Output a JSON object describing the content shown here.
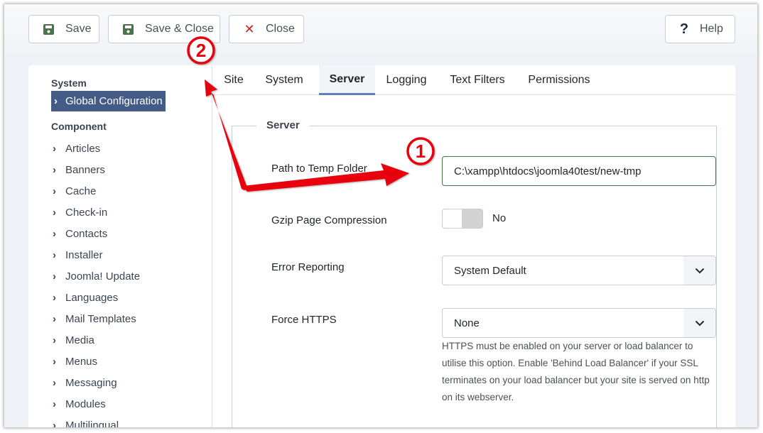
{
  "toolbar": {
    "save": {
      "label": "Save",
      "icon": "floppy-disk-icon",
      "icon_color": "#477549"
    },
    "save_close": {
      "label": "Save & Close",
      "icon": "floppy-disk-icon",
      "icon_color": "#477549"
    },
    "close": {
      "label": "Close",
      "icon": "x-icon",
      "icon_glyph": "✕",
      "icon_color": "#c52827"
    },
    "help": {
      "label": "Help",
      "icon": "question-icon",
      "icon_glyph": "?"
    }
  },
  "sidebar": {
    "system_heading": "System",
    "active_item": "Global Configuration",
    "component_heading": "Component",
    "items": [
      {
        "label": "Articles"
      },
      {
        "label": "Banners"
      },
      {
        "label": "Cache"
      },
      {
        "label": "Check-in"
      },
      {
        "label": "Contacts"
      },
      {
        "label": "Installer"
      },
      {
        "label": "Joomla! Update"
      },
      {
        "label": "Languages"
      },
      {
        "label": "Mail Templates"
      },
      {
        "label": "Media"
      },
      {
        "label": "Menus"
      },
      {
        "label": "Messaging"
      },
      {
        "label": "Modules"
      },
      {
        "label": "Multilingual"
      }
    ],
    "chevron": "›",
    "active_color": "#445b85"
  },
  "tabs": [
    {
      "label": "Site",
      "active": false
    },
    {
      "label": "System",
      "active": false
    },
    {
      "label": "Server",
      "active": true
    },
    {
      "label": "Logging",
      "active": false
    },
    {
      "label": "Text Filters",
      "active": false
    },
    {
      "label": "Permissions",
      "active": false
    }
  ],
  "server": {
    "legend": "Server",
    "temp_path": {
      "label": "Path to Temp Folder",
      "value": "C:\\xampp\\htdocs\\joomla40test/new-tmp"
    },
    "gzip": {
      "label": "Gzip Page Compression",
      "value": "No",
      "enabled": false
    },
    "error_reporting": {
      "label": "Error Reporting",
      "value": "System Default"
    },
    "force_https": {
      "label": "Force HTTPS",
      "value": "None",
      "help": "HTTPS must be enabled on your server or load balancer to utilise this option. Enable 'Behind Load Balancer' if your SSL terminates on your load balancer but your site is served on http on its webserver."
    }
  },
  "annotations": {
    "marker_1": "1",
    "marker_2": "2",
    "color": "#e8000b"
  }
}
